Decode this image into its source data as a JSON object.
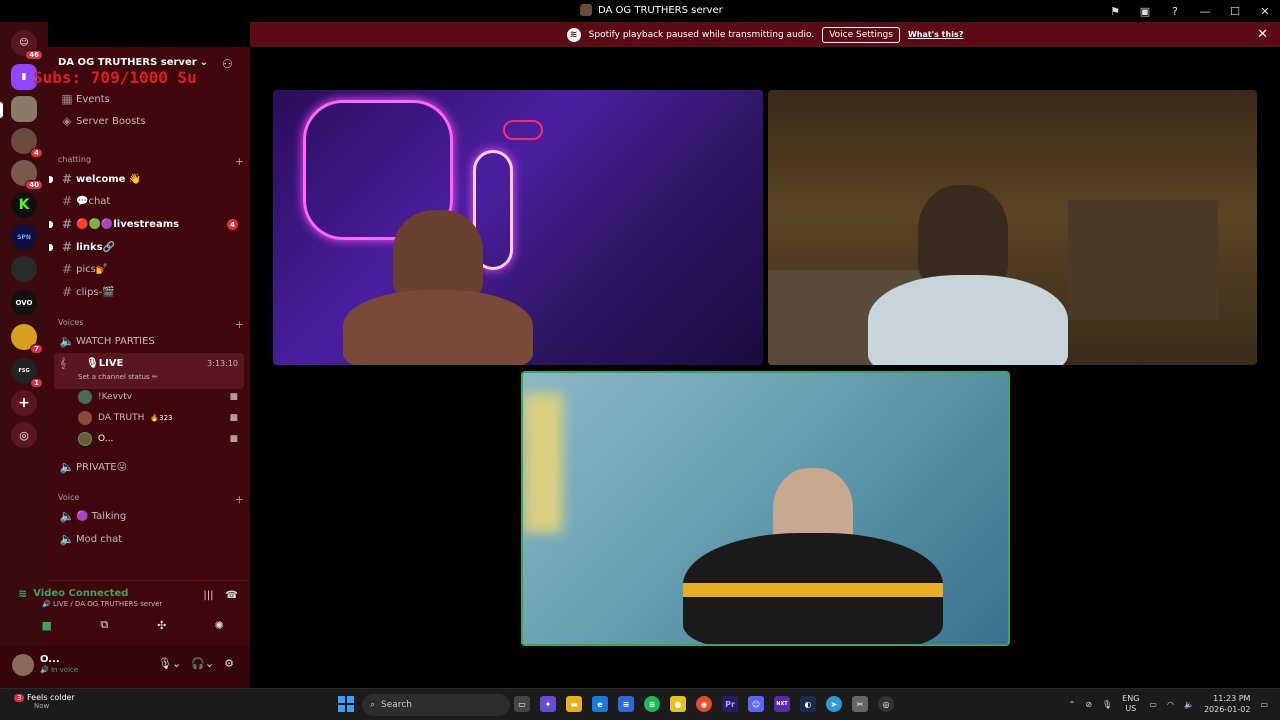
{
  "window": {
    "title": "DA OG TRUTHERS server"
  },
  "banner": {
    "message": "Spotify playback paused while transmitting audio.",
    "voice_settings_label": "Voice Settings",
    "whats_this_label": "What's this?"
  },
  "guilds": {
    "dm_badge": "46",
    "badges": [
      "4",
      "40",
      "7",
      "1"
    ]
  },
  "server": {
    "name": "DA OG TRUTHERS server",
    "overlay_text": "Subs: 709/1000 Su"
  },
  "nav": {
    "events": "Events",
    "boosts": "Server Boosts"
  },
  "categories": {
    "chatting": "chatting",
    "voices": "Voices",
    "voice": "Voice"
  },
  "text_channels": [
    {
      "name": "welcome 👋"
    },
    {
      "name": "💬chat"
    },
    {
      "name": "🔴🟢🟣livestreams",
      "badge": "4"
    },
    {
      "name": "links🔗"
    },
    {
      "name": "pics💅"
    },
    {
      "name": "clips-🎬"
    }
  ],
  "voice_channels": {
    "watch_parties": "WATCH PARTIES",
    "live_name": "🎙LIVE",
    "live_time": "3:13:10",
    "live_status": "Set a channel status ✏",
    "users": [
      {
        "name": "!Kevvtv"
      },
      {
        "name": "DA TRUTH",
        "extra": "🔥323"
      },
      {
        "name": "O..."
      }
    ],
    "private": "PRIVATE😛",
    "talking": "🟣 Talking",
    "mod_chat": "Mod chat"
  },
  "voice_connection": {
    "status": "Video Connected",
    "location": "🔊 LIVE / DA OG TRUTHERS server"
  },
  "user": {
    "name": "O...",
    "status": "🔊 In voice"
  },
  "taskbar": {
    "weather_title": "Feels colder",
    "weather_sub": "Now",
    "weather_badge": "3",
    "search_label": "Search",
    "lang_top": "ENG",
    "lang_bottom": "US",
    "time": "11:23 PM",
    "date": "2026-01-02"
  },
  "colors": {
    "guild_bg": "#3b0a0e",
    "channel_bg": "#3f060d",
    "banner_bg": "#5c0a14",
    "voice_green": "#3ba55d",
    "badge_red": "#e2303a"
  }
}
